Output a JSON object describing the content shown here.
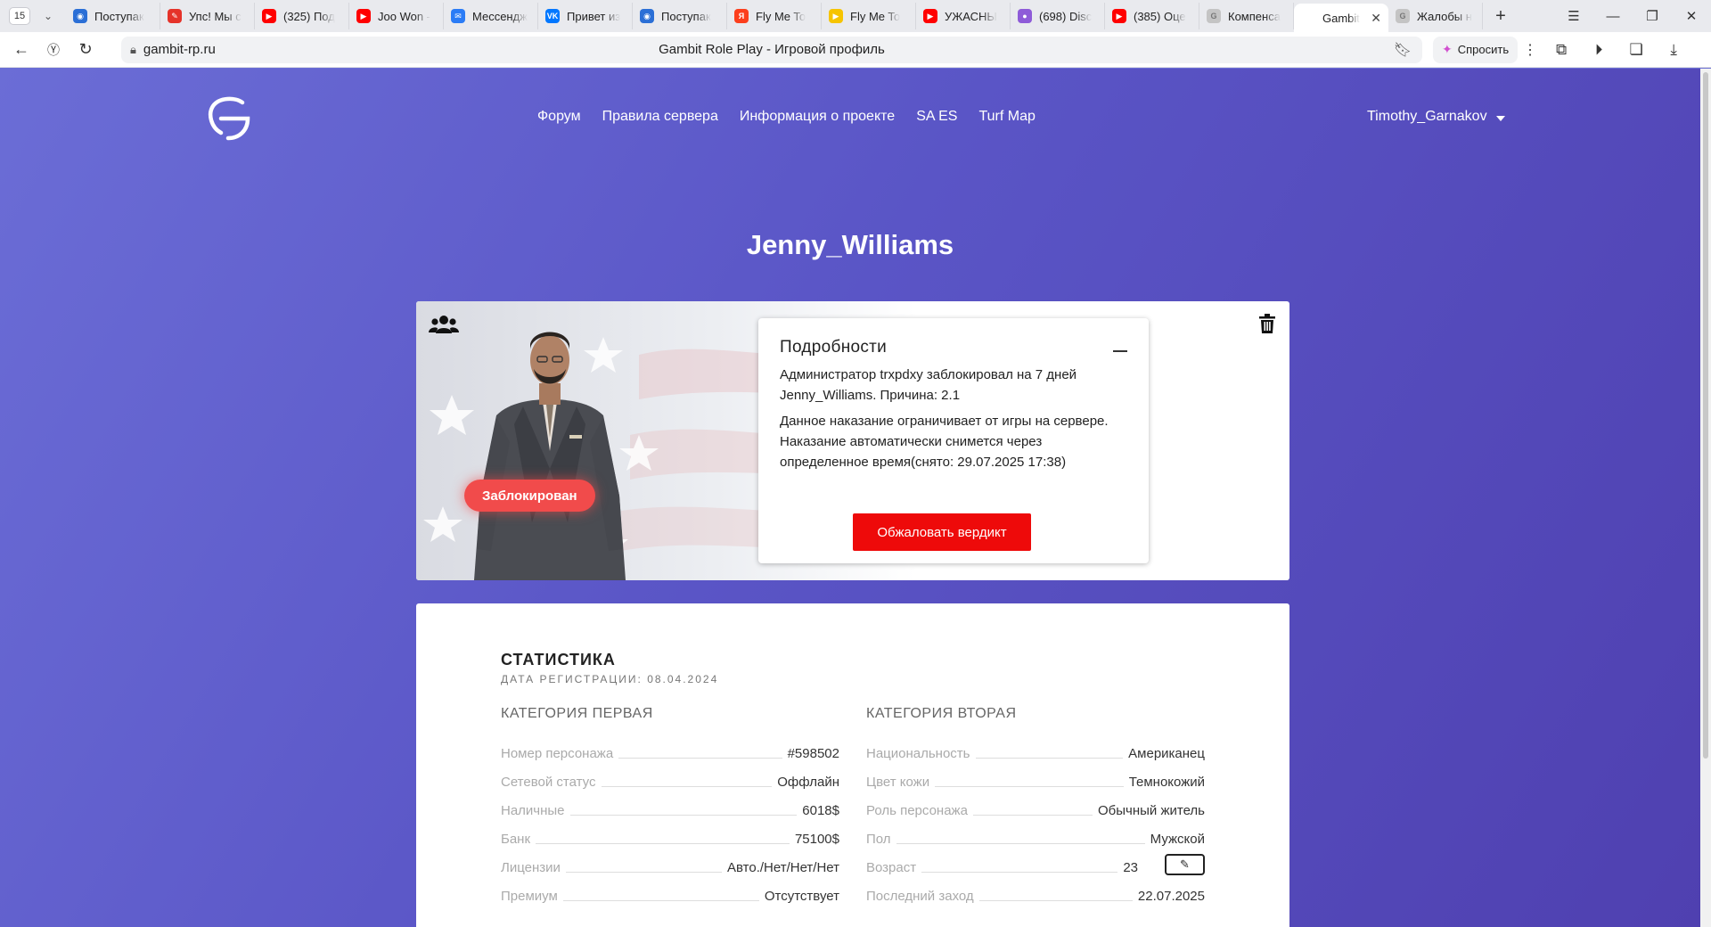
{
  "browser": {
    "tab_count": "15",
    "tabs": [
      {
        "label": "Поступак",
        "color": "#2b6fd6",
        "glyph": "◉"
      },
      {
        "label": "Упс! Мы с",
        "color": "#e5332a",
        "glyph": "✎"
      },
      {
        "label": "(325) Под",
        "color": "#ff0000",
        "glyph": "▶"
      },
      {
        "label": "Joo Won -",
        "color": "#ff0000",
        "glyph": "▶"
      },
      {
        "label": "Мессендж",
        "color": "#2b7cf6",
        "glyph": "✉"
      },
      {
        "label": "Привет из",
        "color": "#0077ff",
        "glyph": "VK"
      },
      {
        "label": "Поступак",
        "color": "#2b6fd6",
        "glyph": "◉"
      },
      {
        "label": "Fly Me To",
        "color": "#fc3f1d",
        "glyph": "Я"
      },
      {
        "label": "Fly Me To",
        "color": "#f6c400",
        "glyph": "▶"
      },
      {
        "label": "УЖАСНЫ",
        "color": "#ff0000",
        "glyph": "▶"
      },
      {
        "label": "(698) Disc",
        "color": "#8e5bd8",
        "glyph": "●"
      },
      {
        "label": "(385) Оце",
        "color": "#ff0000",
        "glyph": "▶"
      },
      {
        "label": "Компенса",
        "color": "#c4c4c4",
        "glyph": "G"
      },
      {
        "label": "Gambit",
        "color": "#ffffff",
        "glyph": "",
        "active": true
      },
      {
        "label": "Жалобы н",
        "color": "#c4c4c4",
        "glyph": "G"
      }
    ],
    "url": "gambit-rp.ru",
    "page_title": "Gambit Role Play - Игровой профиль",
    "ask_label": "Спросить"
  },
  "site": {
    "nav": [
      "Форум",
      "Правила сервера",
      "Информация о проекте",
      "SA ES",
      "Turf Map"
    ],
    "user": "Timothy_Garnakov"
  },
  "profile": {
    "nickname": "Jenny_Williams",
    "status_badge": "Заблокирован",
    "details": {
      "title": "Подробности",
      "line1": "Администратор trxpdxy заблокировал на 7 дней Jenny_Williams. Причина: 2.1",
      "line2": "Данное наказание ограничивает от игры на сервере. Наказание автоматически снимется через определенное время(снято: 29.07.2025 17:38)",
      "appeal_button": "Обжаловать вердикт"
    }
  },
  "stats": {
    "title": "СТАТИСТИКА",
    "registration": "ДАТА РЕГИСТРАЦИИ: 08.04.2024",
    "left": {
      "category": "КАТЕГОРИЯ ПЕРВАЯ",
      "rows": [
        {
          "label": "Номер персонажа",
          "value": "#598502"
        },
        {
          "label": "Сетевой статус",
          "value": "Оффлайн"
        },
        {
          "label": "Наличные",
          "value": "6018$"
        },
        {
          "label": "Банк",
          "value": "75100$"
        },
        {
          "label": "Лицензии",
          "value": "Авто./Нет/Нет/Нет"
        },
        {
          "label": "Премиум",
          "value": "Отсутствует"
        }
      ]
    },
    "right": {
      "category": "КАТЕГОРИЯ ВТОРАЯ",
      "rows": [
        {
          "label": "Национальность",
          "value": "Американец"
        },
        {
          "label": "Цвет кожи",
          "value": "Темнокожий"
        },
        {
          "label": "Роль персонажа",
          "value": "Обычный житель"
        },
        {
          "label": "Пол",
          "value": "Мужской"
        },
        {
          "label": "Возраст",
          "value": "23"
        },
        {
          "label": "Последний заход",
          "value": "22.07.2025"
        }
      ]
    }
  }
}
